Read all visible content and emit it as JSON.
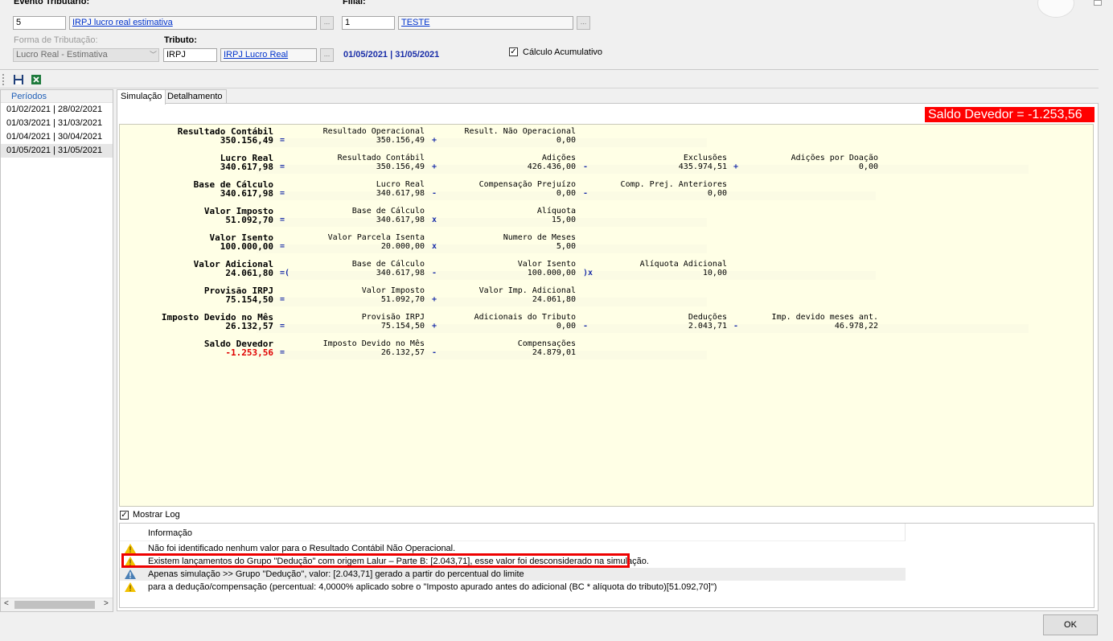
{
  "header": {
    "evento_label": "Evento Tributário:",
    "evento_code": "5",
    "evento_name": "IRPJ lucro real estimativa",
    "filial_label": "Filial:",
    "filial_code": "1",
    "filial_name": "TESTE",
    "forma_label": "Forma de Tributação:",
    "forma_value": "Lucro Real - Estimativa",
    "tributo_label": "Tributo:",
    "tributo_code": "IRPJ",
    "tributo_name": "IRPJ Lucro Real",
    "period": "01/05/2021 | 31/05/2021",
    "calc_acum_label": "Cálculo Acumulativo",
    "dots": "..."
  },
  "toolbar": {
    "save_icon": "save-icon",
    "excel_icon": "excel-icon"
  },
  "periods": {
    "title": "Períodos",
    "items": [
      "01/02/2021 | 28/02/2021",
      "01/03/2021 | 31/03/2021",
      "01/04/2021 | 30/04/2021",
      "01/05/2021 | 31/05/2021"
    ],
    "selected_index": 3
  },
  "tabs": [
    "Simulação",
    "Detalhamento"
  ],
  "saldo_banner": "Saldo Devedor = -1.253,56",
  "sim": {
    "r1": {
      "main_t": "Resultado Contábil",
      "main_v": "350.156,49",
      "op1": "=",
      "c1_t": "Resultado Operacional",
      "c1_v": "350.156,49",
      "op2": "+",
      "c2_t": "Result. Não Operacional",
      "c2_v": "0,00"
    },
    "r2": {
      "main_t": "Lucro Real",
      "main_v": "340.617,98",
      "op1": "=",
      "c1_t": "Resultado Contábil",
      "c1_v": "350.156,49",
      "op2": "+",
      "c2_t": "Adições",
      "c2_v": "426.436,00",
      "op3": "-",
      "c3_t": "Exclusões",
      "c3_v": "435.974,51",
      "op4": "+",
      "c4_t": "Adições  por Doação",
      "c4_v": "0,00"
    },
    "r3": {
      "main_t": "Base de Cálculo",
      "main_v": "340.617,98",
      "op1": "=",
      "c1_t": "Lucro Real",
      "c1_v": "340.617,98",
      "op2": "-",
      "c2_t": "Compensação Prejuízo",
      "c2_v": "0,00",
      "op3": "-",
      "c3_t": "Comp. Prej. Anteriores",
      "c3_v": "0,00"
    },
    "r4": {
      "main_t": "Valor Imposto",
      "main_v": "51.092,70",
      "op1": "=",
      "c1_t": "Base de Cálculo",
      "c1_v": "340.617,98",
      "op2": "x",
      "c2_t": "Alíquota",
      "c2_v": "15,00"
    },
    "r5": {
      "main_t": "Valor Isento",
      "main_v": "100.000,00",
      "op1": "=",
      "c1_t": "Valor Parcela Isenta",
      "c1_v": "20.000,00",
      "op2": "x",
      "c2_t": "Numero de Meses",
      "c2_v": "5,00"
    },
    "r6": {
      "main_t": "Valor Adicional",
      "main_v": "24.061,80",
      "op1": "=(",
      "c1_t": "Base de Cálculo",
      "c1_v": "340.617,98",
      "op2": "-",
      "c2_t": "Valor Isento",
      "c2_v": "100.000,00",
      "op3": ")x",
      "c3_t": "Alíquota Adicional",
      "c3_v": "10,00"
    },
    "r7": {
      "main_t": "Provisão IRPJ",
      "main_v": "75.154,50",
      "op1": "=",
      "c1_t": "Valor Imposto",
      "c1_v": "51.092,70",
      "op2": "+",
      "c2_t": "Valor Imp. Adicional",
      "c2_v": "24.061,80"
    },
    "r8": {
      "main_t": "Imposto Devido no Mês",
      "main_v": "26.132,57",
      "op1": "=",
      "c1_t": "Provisão IRPJ",
      "c1_v": "75.154,50",
      "op2": "+",
      "c2_t": "Adicionais do Tributo",
      "c2_v": "0,00",
      "op3": "-",
      "c3_t": "Deduções",
      "c3_v": "2.043,71",
      "op4": "-",
      "c4_t": "Imp. devido meses ant.",
      "c4_v": "46.978,22"
    },
    "r9": {
      "main_t": "Saldo Devedor",
      "main_v": "-1.253,56",
      "op1": "=",
      "c1_t": "Imposto Devido no Mês",
      "c1_v": "26.132,57",
      "op2": "-",
      "c2_t": "Compensações",
      "c2_v": "24.879,01"
    }
  },
  "log": {
    "show_label": "Mostrar Log",
    "header": "Informação",
    "rows": [
      {
        "icon": "warning-icon",
        "text": "Não foi identificado nenhum valor para o Resultado Contábil Não Operacional."
      },
      {
        "icon": "warning-icon",
        "text": "Existem lançamentos do Grupo \"Dedução\" com origem Lalur – Parte B: [2.043,71], esse valor foi desconsiderado na simulação."
      },
      {
        "icon": "info-triangle-icon",
        "text": "Apenas simulação >> Grupo \"Dedução\", valor: [2.043,71]  gerado a partir do percentual do limite"
      },
      {
        "icon": "warning-icon",
        "text": "para a dedução/compensação (percentual: 4,0000% aplicado sobre o \"Imposto apurado antes do adicional (BC * alíquota do tributo)[51.092,70]\")"
      }
    ]
  },
  "ok_label": "OK",
  "colors": {
    "link": "#0033cc",
    "period": "#1a2ea8",
    "alert": "#ff0000",
    "sim_bg": "#ffffe6"
  }
}
